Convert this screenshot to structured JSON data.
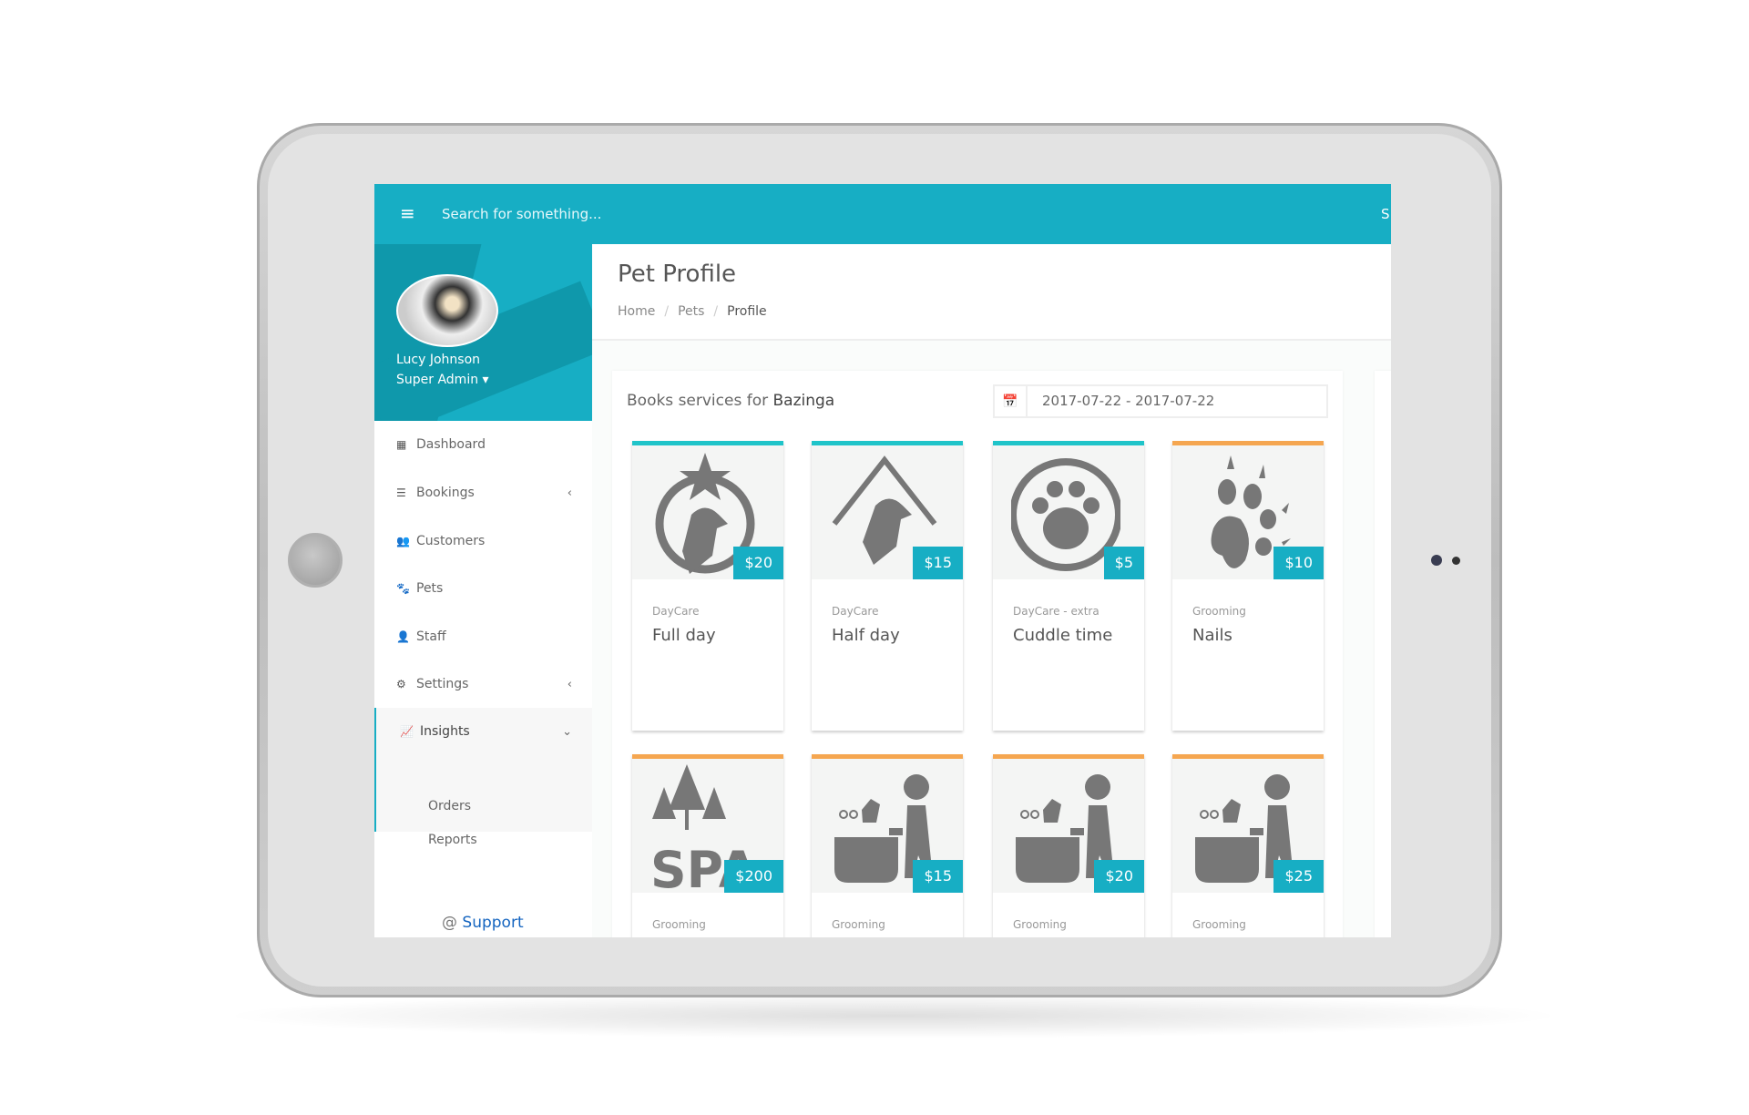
{
  "header": {
    "search_placeholder": "Search for something...",
    "right_cut": "S"
  },
  "user": {
    "name": "Lucy Johnson",
    "role": "Super Admin ▾"
  },
  "sidebar": {
    "items": [
      {
        "label": "Dashboard",
        "icon": "th-large-icon",
        "glyph": "▦"
      },
      {
        "label": "Bookings",
        "icon": "list-icon",
        "glyph": "☰",
        "chevron": "‹"
      },
      {
        "label": "Customers",
        "icon": "users-icon",
        "glyph": "👥"
      },
      {
        "label": "Pets",
        "icon": "paw-icon",
        "glyph": "🐾"
      },
      {
        "label": "Staff",
        "icon": "user-icon",
        "glyph": "👤"
      },
      {
        "label": "Settings",
        "icon": "cogs-icon",
        "glyph": "⚙",
        "chevron": "‹"
      },
      {
        "label": "Insights",
        "icon": "line-chart-icon",
        "glyph": "📈",
        "chevron": "⌄"
      }
    ],
    "subitems": [
      "Orders",
      "Reports"
    ],
    "support_at": "@",
    "support": "Support"
  },
  "page": {
    "title": "Pet Profile",
    "breadcrumb": [
      "Home",
      "Pets",
      "Profile"
    ]
  },
  "panel": {
    "title_prefix": "Books services for",
    "pet": "Bazinga",
    "date_range": "2017-07-22 - 2017-07-22"
  },
  "colors": {
    "accent": "#17aec4",
    "daycare": "#1fc4c9",
    "grooming": "#f5a650"
  },
  "services": [
    {
      "category": "DayCare",
      "name": "Full day",
      "price": "$20",
      "icon": "dog-cat-star-icon",
      "type": "daycare"
    },
    {
      "category": "DayCare",
      "name": "Half day",
      "price": "$15",
      "icon": "dog-cat-house-icon",
      "type": "daycare"
    },
    {
      "category": "DayCare - extra",
      "name": "Cuddle time",
      "price": "$5",
      "icon": "paw-circle-icon",
      "type": "daycare"
    },
    {
      "category": "Grooming",
      "name": "Nails",
      "price": "$10",
      "icon": "paw-claws-icon",
      "type": "grooming"
    },
    {
      "category": "Grooming",
      "name": "",
      "price": "$200",
      "icon": "spa-trees-icon",
      "type": "grooming"
    },
    {
      "category": "Grooming",
      "name": "",
      "price": "$15",
      "icon": "dog-bath-icon",
      "type": "grooming"
    },
    {
      "category": "Grooming",
      "name": "",
      "price": "$20",
      "icon": "dog-bath-icon",
      "type": "grooming"
    },
    {
      "category": "Grooming",
      "name": "",
      "price": "$25",
      "icon": "dog-bath-icon",
      "type": "grooming"
    }
  ]
}
